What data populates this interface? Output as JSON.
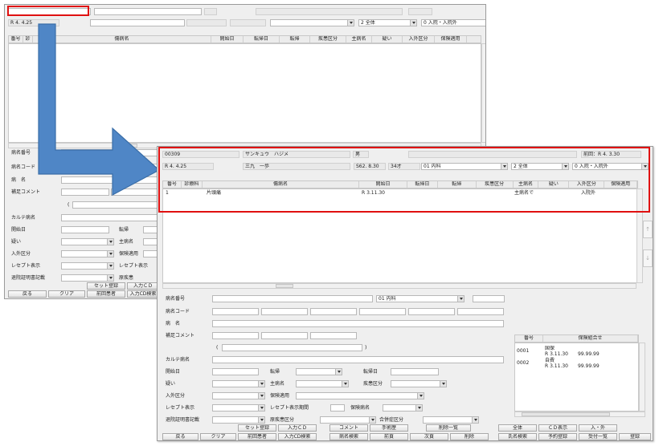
{
  "back": {
    "date": "R 4. 4.25",
    "combo_dept": "",
    "combo_scope": "2 全体",
    "combo_inout": "0 入院・入院外",
    "columns": [
      "番号",
      "診",
      "傷病名",
      "開始日",
      "転帰日",
      "転帰",
      "疾患区分",
      "主病名",
      "疑い",
      "入外区分",
      "保険適用"
    ],
    "labels": {
      "disease_no": "病名番号",
      "disease_code": "病名コード",
      "disease_name": "病　名",
      "supp_comment": "補足コメント",
      "paren": "(",
      "karte": "カルテ病名",
      "start": "開始日",
      "outcome": "転帰",
      "suspect": "疑い",
      "main": "主病名",
      "inout": "入外区分",
      "insurance": "保険適用",
      "receipt": "レセプト表示",
      "receipt_period": "レセプト表示",
      "discharge": "退院証明書記載",
      "source": "原疾患"
    },
    "buttons": {
      "set_register": "セット登録",
      "input_cd": "入力ＣＤ",
      "input_cd_search": "入力CD検索",
      "back": "戻る",
      "clear": "クリア",
      "prev_patient": "前回患者"
    }
  },
  "front": {
    "patient_id": "00309",
    "kana": "サンキュウ　ハジメ",
    "sex": "男",
    "last_visit": "前回：R 4. 3.30",
    "date": "R 4. 4.25",
    "name": "三九　一歩",
    "birth": "S62. 8.30",
    "age": "34才",
    "dept": "01 内科",
    "scope": "2 全体",
    "inout": "0 入院・入院外",
    "columns": [
      "番号",
      "診療科",
      "傷病名",
      "開始日",
      "転帰日",
      "転帰",
      "疾患区分",
      "主病名",
      "疑い",
      "入外区分",
      "保険適用"
    ],
    "rows": [
      {
        "no": "1",
        "dept": "",
        "name": "片頭痛",
        "start": "R 3.11.30",
        "end": "",
        "outcome": "",
        "cat": "",
        "main": "主病名で",
        "sus": "",
        "inout": "入院外",
        "ins": ""
      }
    ],
    "labels": {
      "disease_no": "病名番号",
      "disease_code": "病名コード",
      "disease_name": "病　名",
      "supp_comment": "補足コメント",
      "paren_open": "(",
      "paren_close": ")",
      "karte": "カルテ病名",
      "start": "開始日",
      "outcome": "転帰",
      "outcome_date": "転帰日",
      "suspect": "疑い",
      "main": "主病名",
      "category": "疾患区分",
      "inout": "入外区分",
      "insurance": "保険適用",
      "receipt": "レセプト表示",
      "receipt_period": "レセプト表示期間",
      "insurance_name": "保険病名",
      "discharge": "退院証明書記載",
      "source": "原疾患区分",
      "complication": "合併症区分"
    },
    "dept_field": "01 内科",
    "ins_table": {
      "headers": [
        "番号",
        "保険組合せ"
      ],
      "rows": [
        {
          "no": "0001",
          "line1": "国保",
          "line2": "R 3.11.30　　99.99.99"
        },
        {
          "no": "0002",
          "line1": "自費",
          "line2": "R 3.11.30　　99.99.99"
        }
      ]
    },
    "buttons": {
      "set_register": "セット登録",
      "input_cd": "入力ＣＤ",
      "comment": "コメント",
      "history": "手術歴",
      "delete_list": "削除一覧",
      "all": "全体",
      "cd_display": "ＣＤ表示",
      "in_out": "入・外",
      "back": "戻る",
      "clear": "クリア",
      "prev_patient": "前回患者",
      "input_cd_search": "入力CD検索",
      "disease_search": "病名検索",
      "prev_page": "前頁",
      "next_page": "次頁",
      "delete": "削除",
      "name_search": "氏名検索",
      "reserve": "予約登録",
      "reception": "受付一覧",
      "register": "登録"
    }
  },
  "colors": {
    "highlight": "#e01010",
    "arrow": "#4f86c6"
  }
}
